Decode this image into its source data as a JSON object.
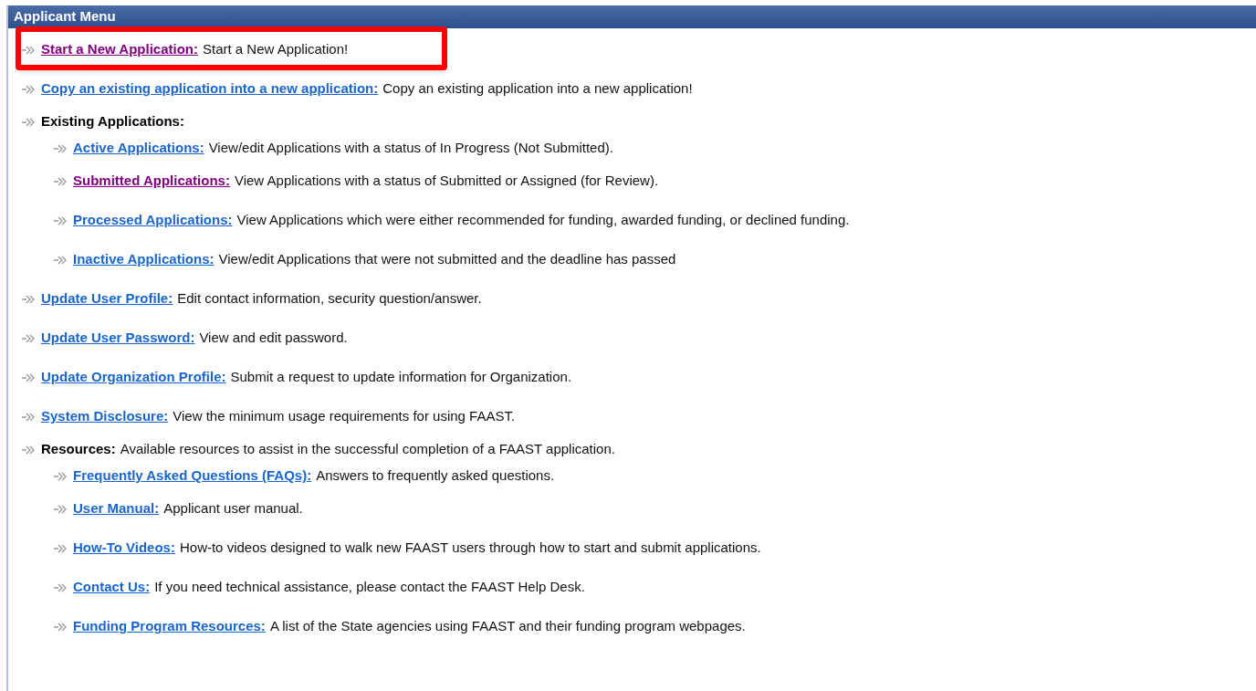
{
  "panel": {
    "title": "Applicant Menu"
  },
  "items": [
    {
      "kind": "link",
      "label": "Start a New Application:",
      "text": "Start a New Application!",
      "visited": true,
      "highlighted": true
    },
    {
      "kind": "link",
      "label": "Copy an existing application into a new application:",
      "text": "Copy an existing application into a new application!",
      "visited": false
    },
    {
      "kind": "heading",
      "label": "Existing Applications:",
      "children": [
        {
          "kind": "link",
          "label": "Active Applications:",
          "text": "View/edit Applications with a status of In Progress (Not Submitted).",
          "visited": false
        },
        {
          "kind": "link",
          "label": "Submitted Applications:",
          "text": "View Applications with a status of Submitted or Assigned (for Review).",
          "visited": true
        },
        {
          "kind": "link",
          "label": "Processed Applications:",
          "text": "View Applications which were either recommended for funding, awarded funding, or declined funding.",
          "visited": false
        },
        {
          "kind": "link",
          "label": "Inactive Applications:",
          "text": "View/edit Applications that were not submitted and the deadline has passed",
          "visited": false
        }
      ]
    },
    {
      "kind": "link",
      "label": "Update User Profile:",
      "text": "Edit contact information, security question/answer.",
      "visited": false
    },
    {
      "kind": "link",
      "label": "Update User Password:",
      "text": "View and edit password.",
      "visited": false
    },
    {
      "kind": "link",
      "label": "Update Organization Profile:",
      "text": "Submit a request to update information for Organization.",
      "visited": false
    },
    {
      "kind": "link",
      "label": "System Disclosure:",
      "text": "View the minimum usage requirements for using FAAST.",
      "visited": false
    },
    {
      "kind": "heading",
      "label": "Resources:",
      "text": "Available resources to assist in the successful completion of a FAAST application.",
      "children": [
        {
          "kind": "link",
          "label": "Frequently Asked Questions (FAQs):",
          "text": "Answers to frequently asked questions.",
          "visited": false
        },
        {
          "kind": "link",
          "label": "User Manual:",
          "text": "Applicant user manual.",
          "visited": false
        },
        {
          "kind": "link",
          "label": "How-To Videos:",
          "text": "How-to videos designed to walk new FAAST users through how to start and submit applications.",
          "visited": false
        },
        {
          "kind": "link",
          "label": "Contact Us:",
          "text": "If you need technical assistance, please contact the FAAST Help Desk.",
          "visited": false
        },
        {
          "kind": "link",
          "label": "Funding Program Resources:",
          "text": "A list of the State agencies using FAAST and their funding program webpages.",
          "visited": false
        }
      ]
    }
  ]
}
